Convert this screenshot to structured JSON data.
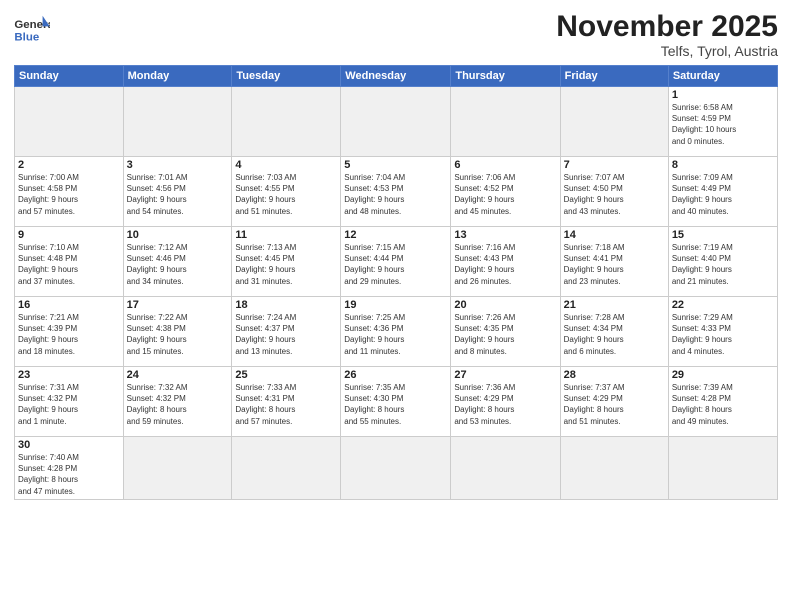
{
  "logo": {
    "text_general": "General",
    "text_blue": "Blue"
  },
  "header": {
    "month": "November 2025",
    "location": "Telfs, Tyrol, Austria"
  },
  "weekdays": [
    "Sunday",
    "Monday",
    "Tuesday",
    "Wednesday",
    "Thursday",
    "Friday",
    "Saturday"
  ],
  "weeks": [
    [
      {
        "day": "",
        "info": "",
        "empty": true
      },
      {
        "day": "",
        "info": "",
        "empty": true
      },
      {
        "day": "",
        "info": "",
        "empty": true
      },
      {
        "day": "",
        "info": "",
        "empty": true
      },
      {
        "day": "",
        "info": "",
        "empty": true
      },
      {
        "day": "",
        "info": "",
        "empty": true
      },
      {
        "day": "1",
        "info": "Sunrise: 6:58 AM\nSunset: 4:59 PM\nDaylight: 10 hours\nand 0 minutes."
      }
    ],
    [
      {
        "day": "2",
        "info": "Sunrise: 7:00 AM\nSunset: 4:58 PM\nDaylight: 9 hours\nand 57 minutes."
      },
      {
        "day": "3",
        "info": "Sunrise: 7:01 AM\nSunset: 4:56 PM\nDaylight: 9 hours\nand 54 minutes."
      },
      {
        "day": "4",
        "info": "Sunrise: 7:03 AM\nSunset: 4:55 PM\nDaylight: 9 hours\nand 51 minutes."
      },
      {
        "day": "5",
        "info": "Sunrise: 7:04 AM\nSunset: 4:53 PM\nDaylight: 9 hours\nand 48 minutes."
      },
      {
        "day": "6",
        "info": "Sunrise: 7:06 AM\nSunset: 4:52 PM\nDaylight: 9 hours\nand 45 minutes."
      },
      {
        "day": "7",
        "info": "Sunrise: 7:07 AM\nSunset: 4:50 PM\nDaylight: 9 hours\nand 43 minutes."
      },
      {
        "day": "8",
        "info": "Sunrise: 7:09 AM\nSunset: 4:49 PM\nDaylight: 9 hours\nand 40 minutes."
      }
    ],
    [
      {
        "day": "9",
        "info": "Sunrise: 7:10 AM\nSunset: 4:48 PM\nDaylight: 9 hours\nand 37 minutes."
      },
      {
        "day": "10",
        "info": "Sunrise: 7:12 AM\nSunset: 4:46 PM\nDaylight: 9 hours\nand 34 minutes."
      },
      {
        "day": "11",
        "info": "Sunrise: 7:13 AM\nSunset: 4:45 PM\nDaylight: 9 hours\nand 31 minutes."
      },
      {
        "day": "12",
        "info": "Sunrise: 7:15 AM\nSunset: 4:44 PM\nDaylight: 9 hours\nand 29 minutes."
      },
      {
        "day": "13",
        "info": "Sunrise: 7:16 AM\nSunset: 4:43 PM\nDaylight: 9 hours\nand 26 minutes."
      },
      {
        "day": "14",
        "info": "Sunrise: 7:18 AM\nSunset: 4:41 PM\nDaylight: 9 hours\nand 23 minutes."
      },
      {
        "day": "15",
        "info": "Sunrise: 7:19 AM\nSunset: 4:40 PM\nDaylight: 9 hours\nand 21 minutes."
      }
    ],
    [
      {
        "day": "16",
        "info": "Sunrise: 7:21 AM\nSunset: 4:39 PM\nDaylight: 9 hours\nand 18 minutes."
      },
      {
        "day": "17",
        "info": "Sunrise: 7:22 AM\nSunset: 4:38 PM\nDaylight: 9 hours\nand 15 minutes."
      },
      {
        "day": "18",
        "info": "Sunrise: 7:24 AM\nSunset: 4:37 PM\nDaylight: 9 hours\nand 13 minutes."
      },
      {
        "day": "19",
        "info": "Sunrise: 7:25 AM\nSunset: 4:36 PM\nDaylight: 9 hours\nand 11 minutes."
      },
      {
        "day": "20",
        "info": "Sunrise: 7:26 AM\nSunset: 4:35 PM\nDaylight: 9 hours\nand 8 minutes."
      },
      {
        "day": "21",
        "info": "Sunrise: 7:28 AM\nSunset: 4:34 PM\nDaylight: 9 hours\nand 6 minutes."
      },
      {
        "day": "22",
        "info": "Sunrise: 7:29 AM\nSunset: 4:33 PM\nDaylight: 9 hours\nand 4 minutes."
      }
    ],
    [
      {
        "day": "23",
        "info": "Sunrise: 7:31 AM\nSunset: 4:32 PM\nDaylight: 9 hours\nand 1 minute."
      },
      {
        "day": "24",
        "info": "Sunrise: 7:32 AM\nSunset: 4:32 PM\nDaylight: 8 hours\nand 59 minutes."
      },
      {
        "day": "25",
        "info": "Sunrise: 7:33 AM\nSunset: 4:31 PM\nDaylight: 8 hours\nand 57 minutes."
      },
      {
        "day": "26",
        "info": "Sunrise: 7:35 AM\nSunset: 4:30 PM\nDaylight: 8 hours\nand 55 minutes."
      },
      {
        "day": "27",
        "info": "Sunrise: 7:36 AM\nSunset: 4:29 PM\nDaylight: 8 hours\nand 53 minutes."
      },
      {
        "day": "28",
        "info": "Sunrise: 7:37 AM\nSunset: 4:29 PM\nDaylight: 8 hours\nand 51 minutes."
      },
      {
        "day": "29",
        "info": "Sunrise: 7:39 AM\nSunset: 4:28 PM\nDaylight: 8 hours\nand 49 minutes."
      }
    ],
    [
      {
        "day": "30",
        "info": "Sunrise: 7:40 AM\nSunset: 4:28 PM\nDaylight: 8 hours\nand 47 minutes."
      },
      {
        "day": "",
        "info": "",
        "empty": true
      },
      {
        "day": "",
        "info": "",
        "empty": true
      },
      {
        "day": "",
        "info": "",
        "empty": true
      },
      {
        "day": "",
        "info": "",
        "empty": true
      },
      {
        "day": "",
        "info": "",
        "empty": true
      },
      {
        "day": "",
        "info": "",
        "empty": true
      }
    ]
  ]
}
